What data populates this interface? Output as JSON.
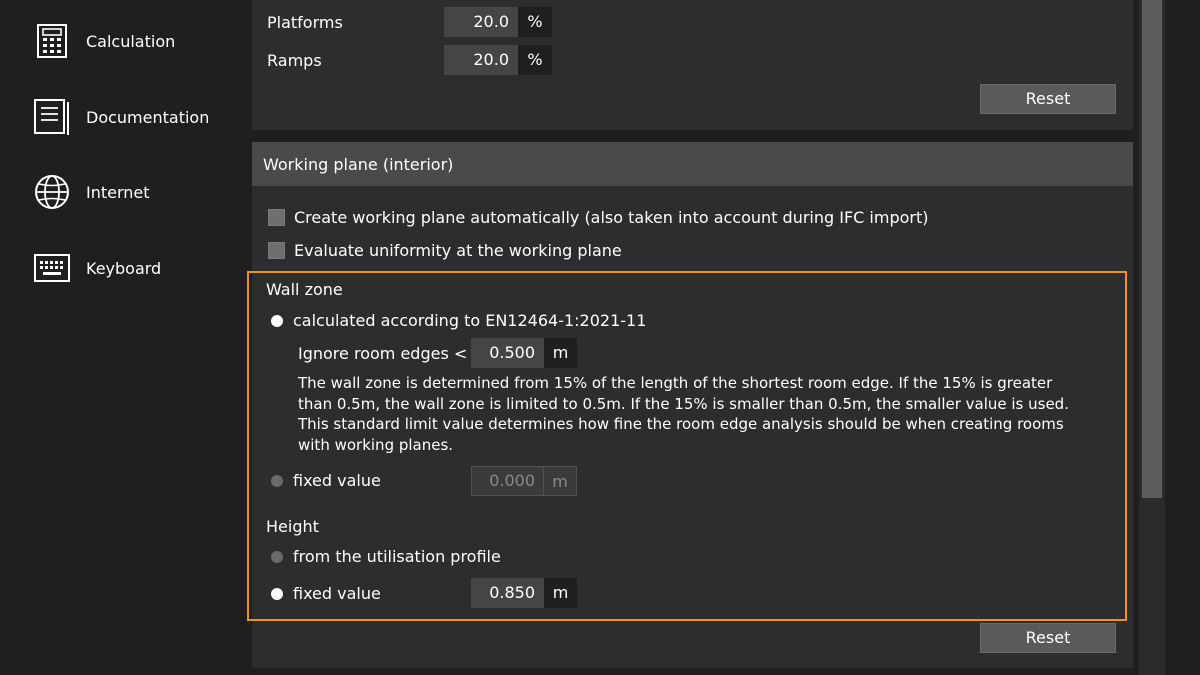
{
  "sidebar": {
    "items": [
      {
        "label": "Calculation",
        "icon": "calculator-icon"
      },
      {
        "label": "Documentation",
        "icon": "document-icon"
      },
      {
        "label": "Internet",
        "icon": "globe-icon"
      },
      {
        "label": "Keyboard",
        "icon": "keyboard-icon"
      }
    ]
  },
  "top_section": {
    "rows": [
      {
        "label": "Platforms",
        "value": "20.0",
        "unit": "%"
      },
      {
        "label": "Ramps",
        "value": "20.0",
        "unit": "%"
      }
    ],
    "reset_label": "Reset"
  },
  "working_plane": {
    "title": "Working plane (interior)",
    "checkbox_create": "Create working plane automatically (also taken into account during IFC import)",
    "checkbox_uniformity": "Evaluate uniformity at the working plane",
    "wall_zone": {
      "title": "Wall zone",
      "option_calculated": "calculated according to EN12464-1:2021-11",
      "ignore_label": "Ignore room edges <",
      "ignore_value": "0.500",
      "ignore_unit": "m",
      "description": "The wall zone is determined from 15% of the length of the shortest room edge. If the 15% is greater than 0.5m, the wall zone is limited to 0.5m. If the 15% is smaller than 0.5m, the smaller value is used. This standard limit value determines how fine the room edge analysis should be when creating rooms with working planes.",
      "option_fixed": "fixed value",
      "fixed_value": "0.000",
      "fixed_unit": "m",
      "selected": "calculated"
    },
    "height": {
      "title": "Height",
      "option_profile": "from the utilisation profile",
      "option_fixed": "fixed value",
      "fixed_value": "0.850",
      "fixed_unit": "m",
      "selected": "fixed"
    },
    "reset_label": "Reset"
  },
  "colors": {
    "highlight": "#f5940a",
    "background": "#1f1f1f",
    "panel": "#2d2d2d",
    "section_header": "#4a4a4a"
  }
}
